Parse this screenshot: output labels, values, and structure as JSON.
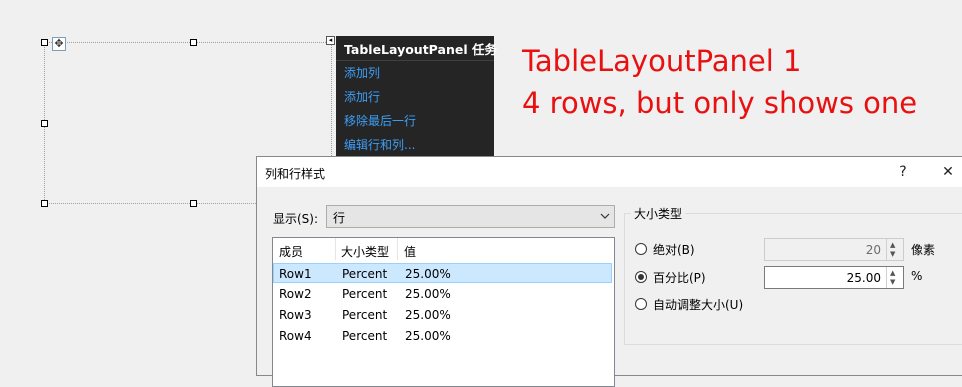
{
  "task_menu": {
    "title": "TableLayoutPanel 任务",
    "items": [
      "添加列",
      "添加行",
      "移除最后一行",
      "编辑行和列..."
    ]
  },
  "annotation": {
    "line1": "TableLayoutPanel 1",
    "line2": "4 rows, but only shows one",
    "color": "#e81010"
  },
  "dialog": {
    "title": "列和行样式",
    "help_button": "?",
    "close_button": "✕",
    "show_label": "显示(S):",
    "show_value": "行",
    "columns": [
      "成员",
      "大小类型",
      "值"
    ],
    "rows": [
      {
        "member": "Row1",
        "size_type": "Percent",
        "value": "25.00%",
        "selected": true
      },
      {
        "member": "Row2",
        "size_type": "Percent",
        "value": "25.00%",
        "selected": false
      },
      {
        "member": "Row3",
        "size_type": "Percent",
        "value": "25.00%",
        "selected": false
      },
      {
        "member": "Row4",
        "size_type": "Percent",
        "value": "25.00%",
        "selected": false
      }
    ],
    "size_type": {
      "legend": "大小类型",
      "absolute_label": "绝对(B)",
      "absolute_value": "20",
      "absolute_unit": "像素",
      "percent_label": "百分比(P)",
      "percent_value": "25.00",
      "percent_unit": "%",
      "auto_label": "自动调整大小(U)",
      "selected": "percent"
    }
  },
  "icons": {
    "move": "move-icon",
    "smart_tag": "smart-tag-arrow-icon",
    "dropdown": "chevron-down-icon"
  }
}
